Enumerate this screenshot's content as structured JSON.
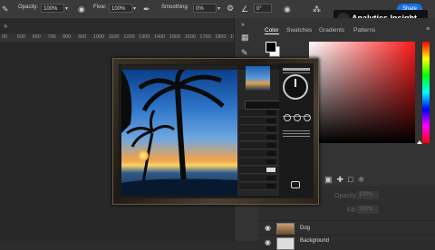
{
  "options_bar": {
    "opacity_label": "Opacity:",
    "opacity_value": "100%",
    "flow_label": "Flow:",
    "flow_value": "100%",
    "smoothing_label": "Smoothing:",
    "smoothing_value": "0%",
    "angle_value": "0°",
    "share_label": "Share"
  },
  "logo": {
    "text": "Analytics Insight"
  },
  "ruler": {
    "ticks": [
      "00",
      "500",
      "600",
      "700",
      "800",
      "900",
      "1000",
      "1100",
      "1200",
      "1300",
      "1400",
      "1500",
      "1600",
      "1700",
      "1800",
      "19"
    ]
  },
  "panel": {
    "tabs": [
      "Color",
      "Swatches",
      "Gradients",
      "Patterns"
    ]
  },
  "layers": {
    "opacity_label": "Opacity:",
    "opacity_value": "100%",
    "fill_label": "Fill:",
    "fill_value": "100%",
    "rows": [
      {
        "name": "Dog"
      },
      {
        "name": "Background"
      }
    ]
  },
  "colors": {
    "accent": "#1473e6",
    "panel_bg": "#333333",
    "frame": "#3b3328"
  }
}
